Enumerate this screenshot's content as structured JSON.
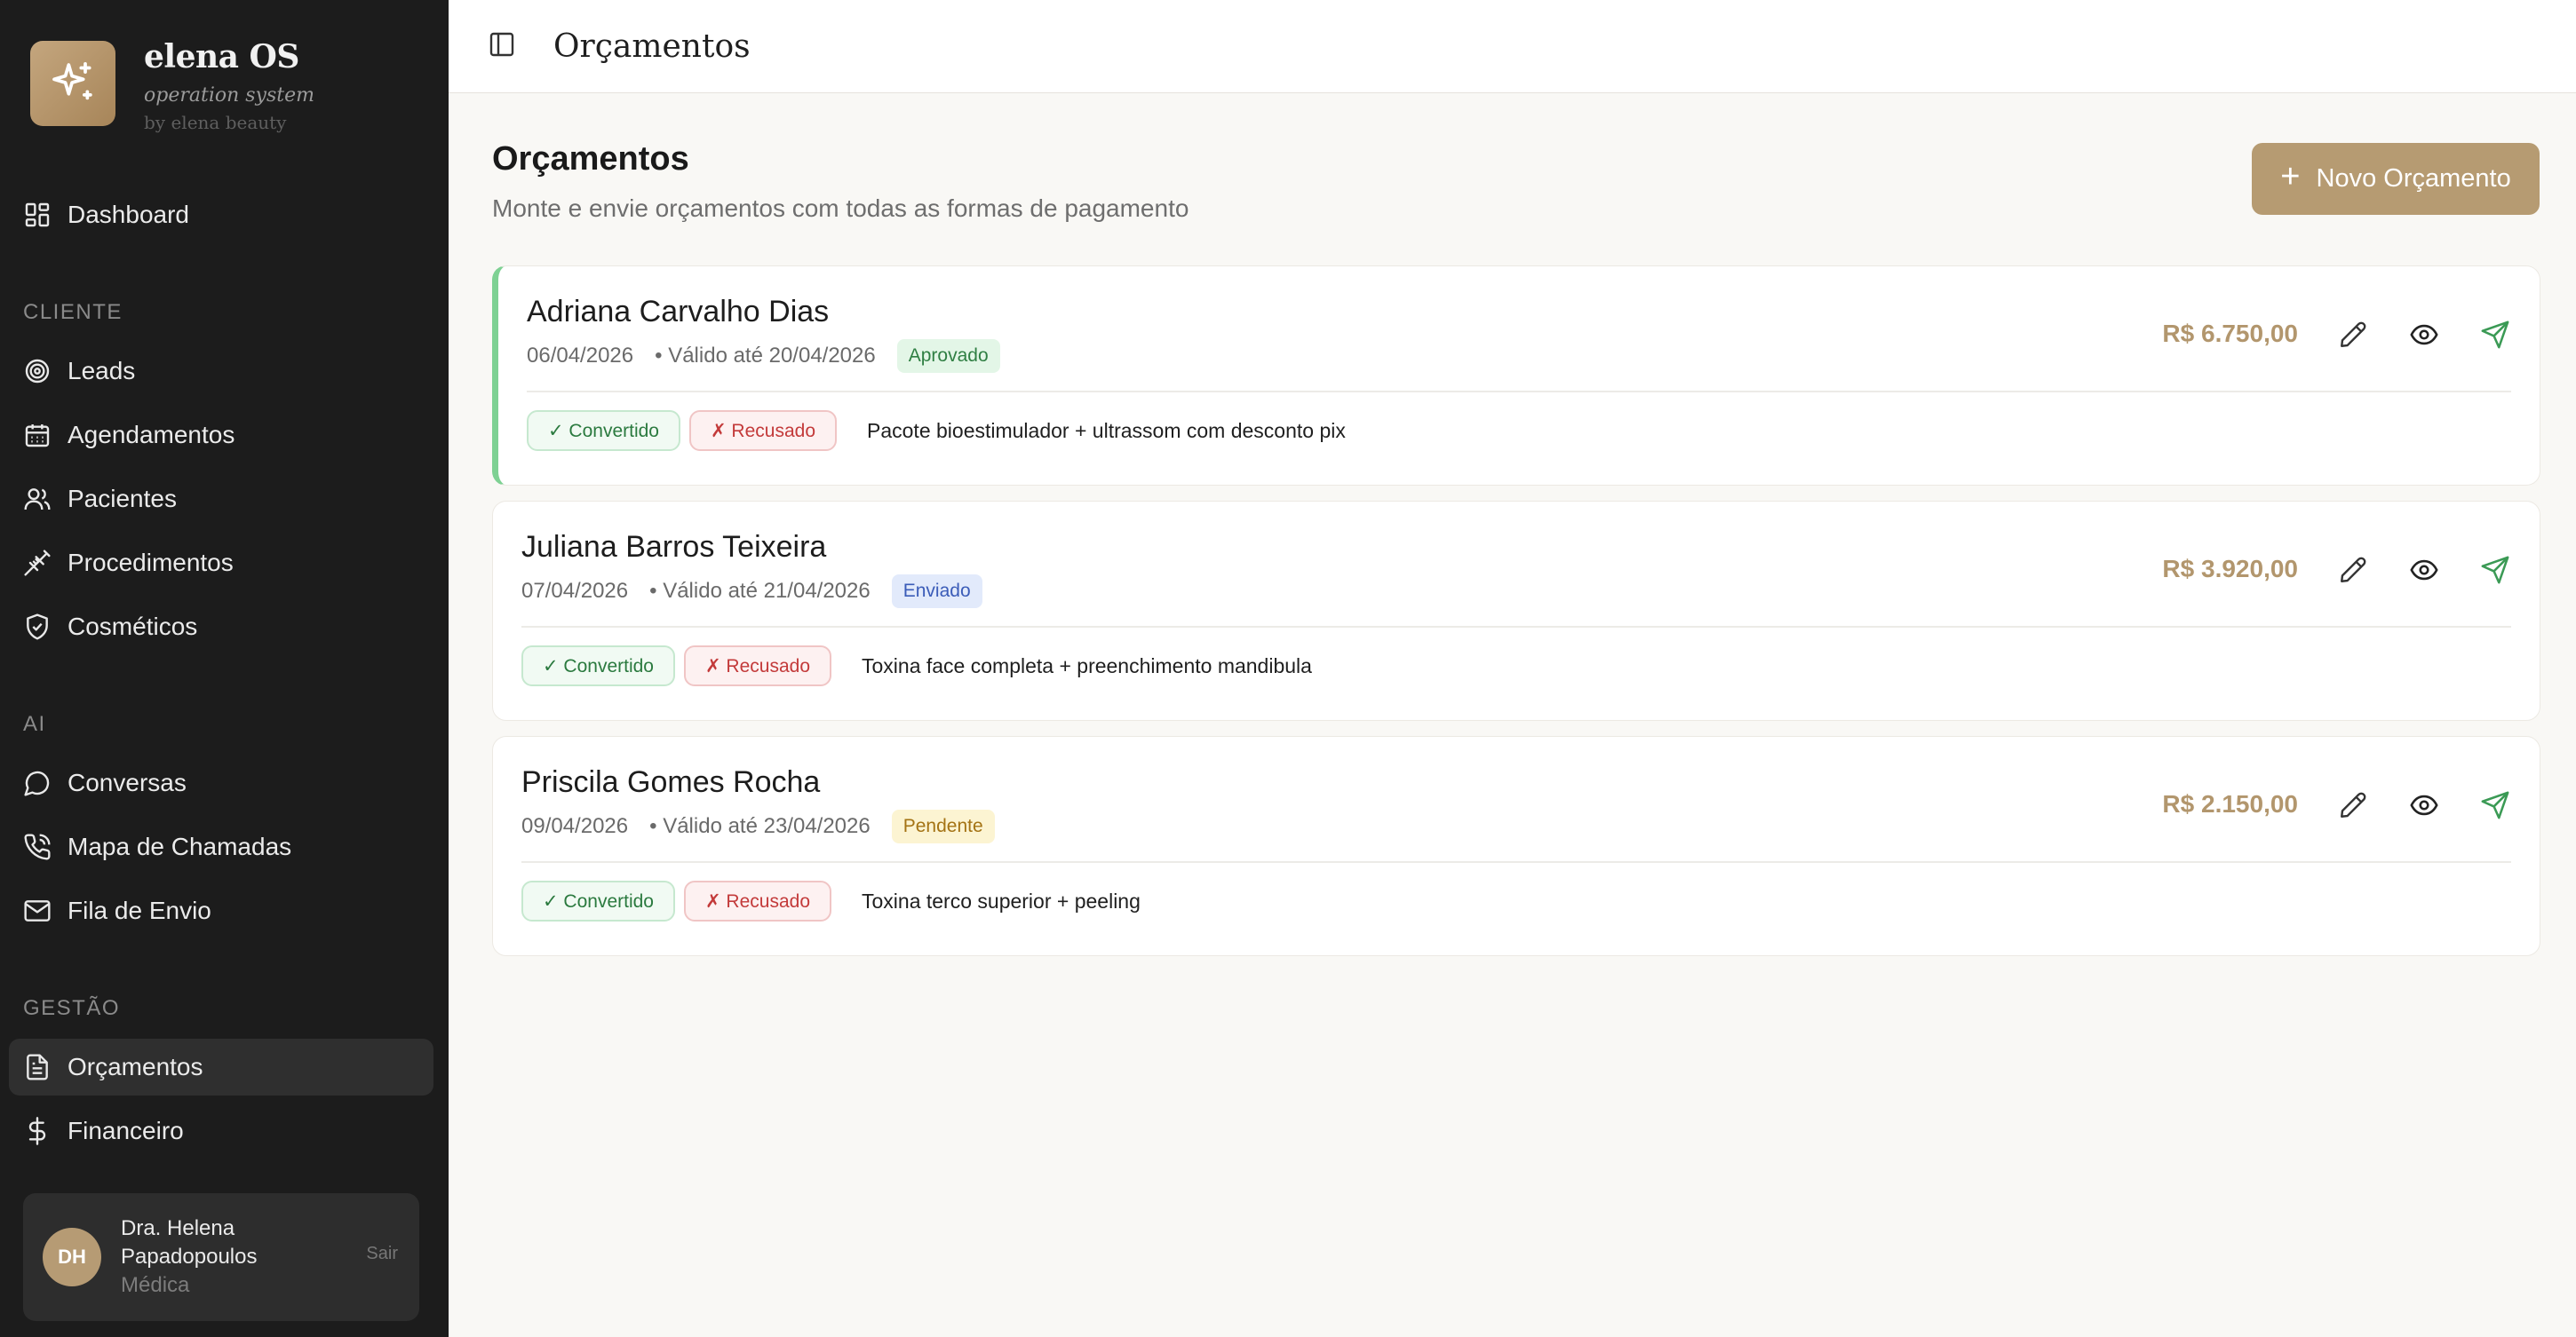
{
  "brand": {
    "name": "elena OS",
    "subtitle": "operation system",
    "by": "by elena beauty"
  },
  "sidebar": {
    "dashboard": "Dashboard",
    "sections": {
      "cliente": "CLIENTE",
      "ai": "AI",
      "gestao": "GESTÃO"
    },
    "cliente_items": [
      "Leads",
      "Agendamentos",
      "Pacientes",
      "Procedimentos",
      "Cosméticos"
    ],
    "ai_items": [
      "Conversas",
      "Mapa de Chamadas",
      "Fila de Envio"
    ],
    "gestao_items": [
      "Orçamentos",
      "Financeiro"
    ],
    "active_item": "Orçamentos"
  },
  "user": {
    "initials": "DH",
    "name": "Dra. Helena Papadopoulos",
    "role": "Médica",
    "logout": "Sair"
  },
  "topbar": {
    "title": "Orçamentos"
  },
  "page": {
    "title": "Orçamentos",
    "subtitle": "Monte e envie orçamentos com todas as formas de pagamento",
    "new_button": "Novo Orçamento"
  },
  "quotes": [
    {
      "name": "Adriana Carvalho Dias",
      "date": "06/04/2026",
      "valid": "• Válido até 20/04/2026",
      "status": "Aprovado",
      "price": "R$ 6.750,00",
      "converted_label": "✓ Convertido",
      "refused_label": "✗ Recusado",
      "description": "Pacote bioestimulador + ultrassom com desconto pix"
    },
    {
      "name": "Juliana Barros Teixeira",
      "date": "07/04/2026",
      "valid": "• Válido até 21/04/2026",
      "status": "Enviado",
      "price": "R$ 3.920,00",
      "converted_label": "✓ Convertido",
      "refused_label": "✗ Recusado",
      "description": "Toxina face completa + preenchimento mandibula"
    },
    {
      "name": "Priscila Gomes Rocha",
      "date": "09/04/2026",
      "valid": "• Válido até 23/04/2026",
      "status": "Pendente",
      "price": "R$ 2.150,00",
      "converted_label": "✓ Convertido",
      "refused_label": "✗ Recusado",
      "description": "Toxina terco superior + peeling"
    }
  ],
  "icons": {
    "logo": "sparkles-icon",
    "toggle": "sidebar-toggle-icon",
    "edit": "pencil-icon",
    "view": "eye-icon",
    "send": "send-icon"
  },
  "colors": {
    "accent": "#b69b72",
    "sidebar_bg": "#1c1c1c",
    "approved": "#7ed193",
    "send_icon": "#3b9a55"
  }
}
